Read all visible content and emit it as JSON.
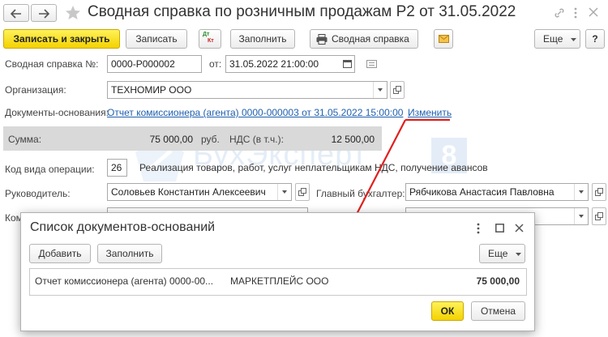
{
  "window": {
    "title": "Сводная справка по розничным продажам Р2 от 31.05.2022"
  },
  "toolbar": {
    "save_close": "Записать и закрыть",
    "save": "Записать",
    "dt_label_top": "Дт",
    "dt_label_bottom": "Кт",
    "fill": "Заполнить",
    "summary_report": "Сводная справка",
    "more": "Еще",
    "help": "?"
  },
  "form": {
    "number_label": "Сводная справка №:",
    "number_value": "0000-Р000002",
    "date_label": "от:",
    "date_value": "31.05.2022 21:00:00",
    "org_label": "Организация:",
    "org_value": "ТЕХНОМИР ООО",
    "docs_label": "Документы-основания:",
    "docs_link": "Отчет комиссионера (агента) 0000-000003 от 31.05.2022 15:00:00",
    "change_link": "Изменить",
    "sum_label": "Сумма:",
    "sum_value": "75 000,00",
    "currency": "руб.",
    "vat_label": "НДС (в т.ч.):",
    "vat_value": "12 500,00",
    "op_code_label": "Код вида операции:",
    "op_code_value": "26",
    "op_code_desc": "Реализация товаров, работ, услуг неплательщикам НДС, получение авансов",
    "head_label": "Руководитель:",
    "head_value": "Соловьев Константин Алексеевич",
    "accountant_label": "Главный бухгалтер:",
    "accountant_value": "Рябчикова Анастасия Павловна",
    "comment_label_partial": "Ком"
  },
  "watermark": {
    "text": "БухЭксперт",
    "digit": "8"
  },
  "dialog": {
    "title": "Список документов-оснований",
    "add": "Добавить",
    "fill": "Заполнить",
    "more": "Еще",
    "rows": [
      {
        "document": "Отчет комиссионера (агента) 0000-00...",
        "counterparty": "МАРКЕТПЛЕЙС ООО",
        "amount": "75 000,00"
      }
    ],
    "ok": "ОК",
    "cancel": "Отмена"
  },
  "colors": {
    "primary_button": "#f3d200",
    "link": "#1f5fae",
    "annotation": "#e0201e"
  }
}
